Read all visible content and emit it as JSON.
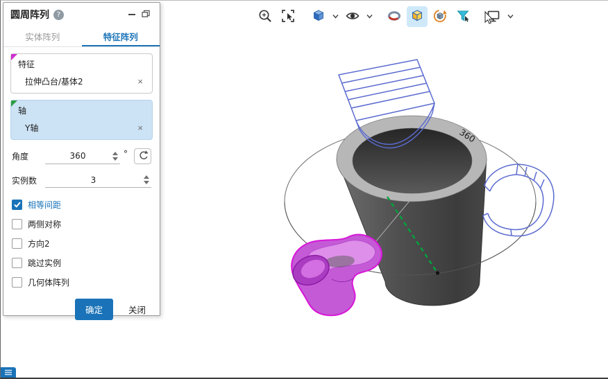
{
  "dialog": {
    "title": "圆周阵列",
    "help_text": "?",
    "tabs": {
      "solid": "实体阵列",
      "feature": "特征阵列"
    },
    "feature_group": {
      "label": "特征",
      "selection": "拉伸凸台/基体2",
      "remove_glyph": "×"
    },
    "axis_group": {
      "label": "轴",
      "selection": "Y轴",
      "remove_glyph": "×"
    },
    "angle": {
      "label": "角度",
      "value": "360",
      "unit": "°"
    },
    "instances": {
      "label": "实例数",
      "value": "3"
    },
    "options": [
      {
        "label": "相等间距",
        "checked": true
      },
      {
        "label": "两侧对称",
        "checked": false
      },
      {
        "label": "方向2",
        "checked": false
      },
      {
        "label": "跳过实例",
        "checked": false
      },
      {
        "label": "几何体阵列",
        "checked": false
      }
    ],
    "buttons": {
      "ok": "确定",
      "close": "关闭"
    }
  },
  "toolbar": {
    "items": [
      {
        "icon": "zoom-icon",
        "dropdown": false,
        "active": false
      },
      {
        "icon": "box-select-icon",
        "dropdown": false,
        "active": false
      },
      {
        "icon": "view-orientation-cube-icon",
        "dropdown": true,
        "active": false
      },
      {
        "icon": "visibility-eye-icon",
        "dropdown": true,
        "active": false
      },
      {
        "icon": "section-view-icon",
        "dropdown": false,
        "active": false
      },
      {
        "icon": "shaded-view-cube-icon",
        "dropdown": false,
        "active": true
      },
      {
        "icon": "rotate-view-icon",
        "dropdown": false,
        "active": false
      },
      {
        "icon": "selection-filter-icon",
        "dropdown": false,
        "active": false
      },
      {
        "icon": "display-settings-icon",
        "dropdown": true,
        "active": false
      }
    ]
  },
  "viewport": {
    "dimension_label": "360"
  },
  "colors": {
    "accent_blue": "#1a73b8",
    "selection_fill": "#cce2f5",
    "preview_wireframe_blue": "#5b6bd0",
    "selected_feature_magenta": "#d816d8",
    "axis_green": "#00a33d"
  }
}
